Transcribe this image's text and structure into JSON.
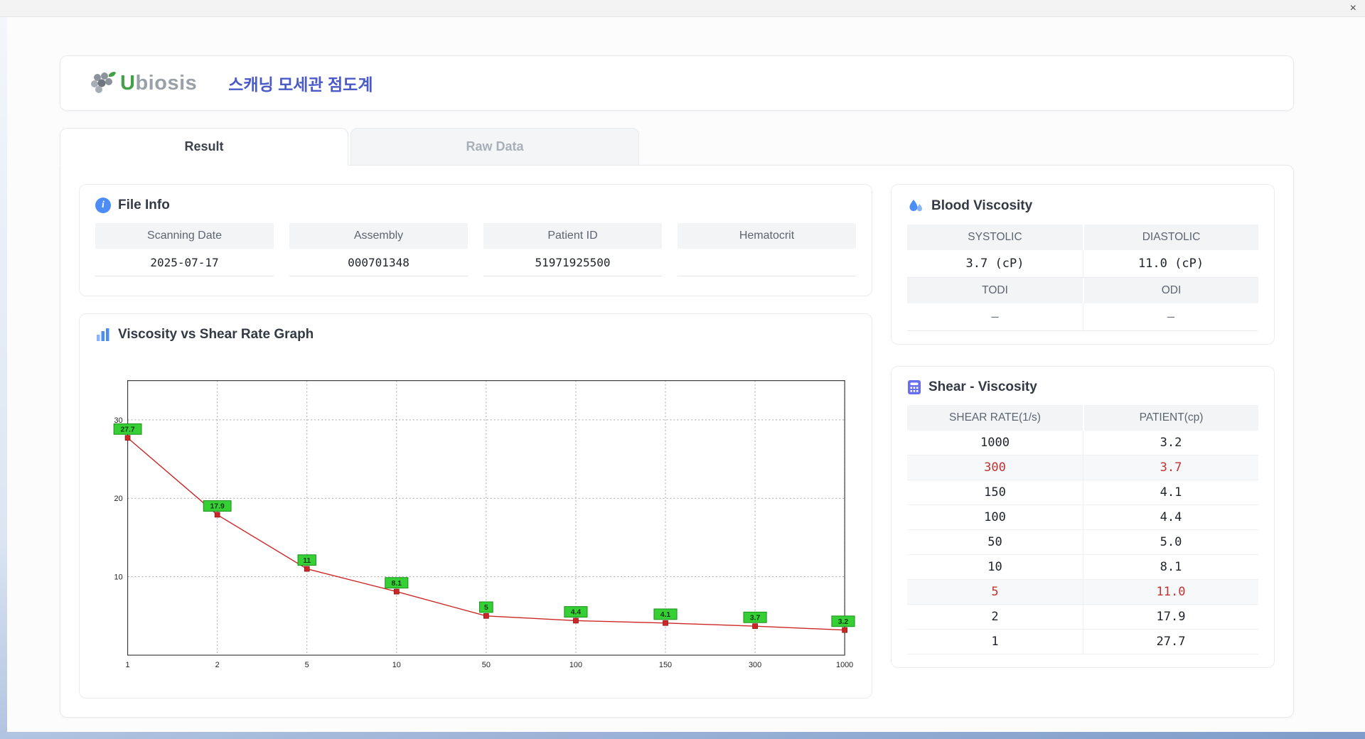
{
  "window": {
    "close_label": "×"
  },
  "header": {
    "logo_u": "U",
    "logo_rest": "biosis",
    "title": "스캐닝 모세관 점도계"
  },
  "tabs": {
    "result": "Result",
    "raw_data": "Raw Data"
  },
  "file_info": {
    "title": "File Info",
    "fields": [
      {
        "label": "Scanning Date",
        "value": "2025-07-17"
      },
      {
        "label": "Assembly",
        "value": "000701348"
      },
      {
        "label": "Patient ID",
        "value": "51971925500"
      },
      {
        "label": "Hematocrit",
        "value": ""
      }
    ]
  },
  "blood_viscosity": {
    "title": "Blood Viscosity",
    "cells": [
      {
        "label": "SYSTOLIC",
        "value": "3.7 (cP)"
      },
      {
        "label": "DIASTOLIC",
        "value": "11.0 (cP)"
      },
      {
        "label": "TODI",
        "value": "–"
      },
      {
        "label": "ODI",
        "value": "–"
      }
    ]
  },
  "graph": {
    "title": "Viscosity vs Shear Rate Graph"
  },
  "chart_data": {
    "type": "line",
    "title": "Viscosity vs Shear Rate Graph",
    "categories": [
      1,
      2,
      5,
      10,
      50,
      100,
      150,
      300,
      1000
    ],
    "values": [
      27.7,
      17.9,
      11,
      8.1,
      5,
      4.4,
      4.1,
      3.7,
      3.2
    ],
    "point_labels": [
      "27.7",
      "17.9",
      "11",
      "8.1",
      "5",
      "4.4",
      "4.1",
      "3.7",
      "3.2"
    ],
    "xlabel": "",
    "ylabel": "",
    "ylim": [
      0,
      35
    ],
    "yticks": [
      10,
      20,
      30
    ],
    "grid": true,
    "x_axis_spacing": "categorical",
    "legend": "none",
    "line_color": "#cc2626",
    "marker_color": "#cc2626",
    "label_bg": "#36cf36"
  },
  "shear_table": {
    "title": "Shear - Viscosity",
    "columns": [
      "SHEAR RATE(1/s)",
      "PATIENT(cp)"
    ],
    "rows": [
      {
        "rate": "1000",
        "patient": "3.2",
        "highlight": false
      },
      {
        "rate": "300",
        "patient": "3.7",
        "highlight": true
      },
      {
        "rate": "150",
        "patient": "4.1",
        "highlight": false
      },
      {
        "rate": "100",
        "patient": "4.4",
        "highlight": false
      },
      {
        "rate": "50",
        "patient": "5.0",
        "highlight": false
      },
      {
        "rate": "10",
        "patient": "8.1",
        "highlight": false
      },
      {
        "rate": "5",
        "patient": "11.0",
        "highlight": true
      },
      {
        "rate": "2",
        "patient": "17.9",
        "highlight": false
      },
      {
        "rate": "1",
        "patient": "27.7",
        "highlight": false
      }
    ]
  },
  "colors": {
    "accent_blue": "#4c8df5",
    "accent_indigo": "#6a6ff0",
    "title_blue": "#4a5bc8",
    "logo_green": "#43a047",
    "highlight_red": "#c43131"
  }
}
